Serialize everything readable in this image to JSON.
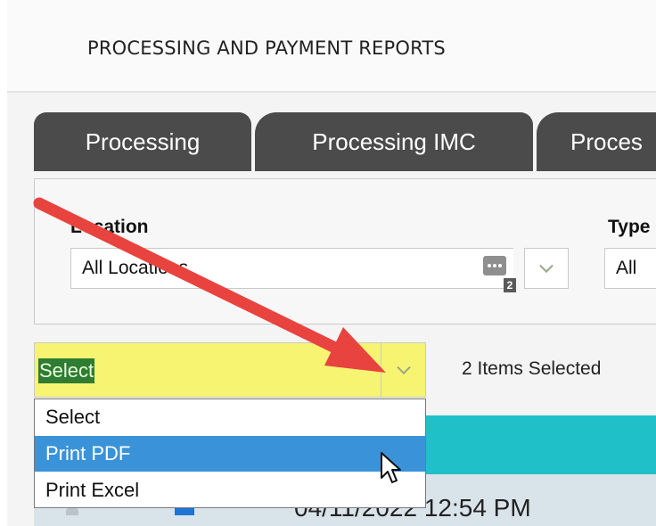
{
  "header": {
    "title": "PROCESSING AND PAYMENT REPORTS"
  },
  "tabs": [
    {
      "label": "Processing"
    },
    {
      "label": "Processing IMC"
    },
    {
      "label": "Proces"
    }
  ],
  "filters": {
    "location": {
      "label": "Location",
      "value": "All Locations",
      "badge_count": "2"
    },
    "type": {
      "label": "Type",
      "value": "All"
    }
  },
  "actions": {
    "selected_value": "Select",
    "selected_count_text": "2 Items Selected",
    "options": [
      "Select",
      "Print PDF",
      "Print Excel"
    ],
    "highlighted_option": "Print PDF"
  },
  "table": {
    "first_row_datetime": "04/11/2022 12:54 PM"
  },
  "colors": {
    "tab_bg": "#4b4b4b",
    "select_highlight": "#f7f472",
    "option_hover": "#3a93d8",
    "table_header": "#1fc0c8",
    "annotation_arrow": "#e8433f"
  }
}
